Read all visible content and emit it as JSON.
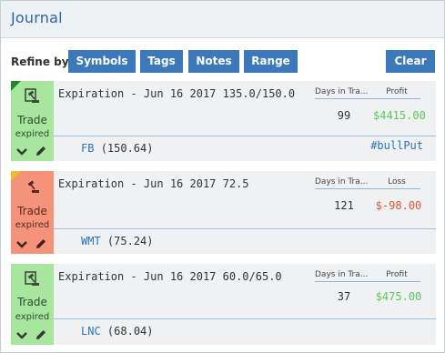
{
  "header": {
    "title": "Journal"
  },
  "refine": {
    "label": "Refine by:",
    "buttons": [
      "Symbols",
      "Tags",
      "Notes",
      "Range"
    ],
    "clear_label": "Clear"
  },
  "colors": {
    "accent": "#3c79ba",
    "profit": "#5cc85a",
    "loss": "#e2582d",
    "expired_green": "#a8e6a0",
    "expired_red": "#f4927a"
  },
  "entries": [
    {
      "status": "Trade",
      "status_sub": "expired",
      "description": "Expiration - Jun 16 2017 135.0/150.0",
      "days_header": "Days in Tra...",
      "days": "99",
      "pl_header": "Profit",
      "pl_value": "$4415.00",
      "symbol": "FB",
      "price": "(150.64)",
      "tag": "#bullPut"
    },
    {
      "status": "Trade",
      "status_sub": "expired",
      "description": "Expiration - Jun 16 2017 72.5",
      "days_header": "Days in Tra...",
      "days": "121",
      "pl_header": "Loss",
      "pl_value": "$-98.00",
      "symbol": "WMT",
      "price": "(75.24)",
      "tag": ""
    },
    {
      "status": "Trade",
      "status_sub": "expired",
      "description": "Expiration - Jun 16 2017 60.0/65.0",
      "days_header": "Days in Tra...",
      "days": "37",
      "pl_header": "Profit",
      "pl_value": "$475.00",
      "symbol": "LNC",
      "price": "(68.04)",
      "tag": ""
    }
  ]
}
